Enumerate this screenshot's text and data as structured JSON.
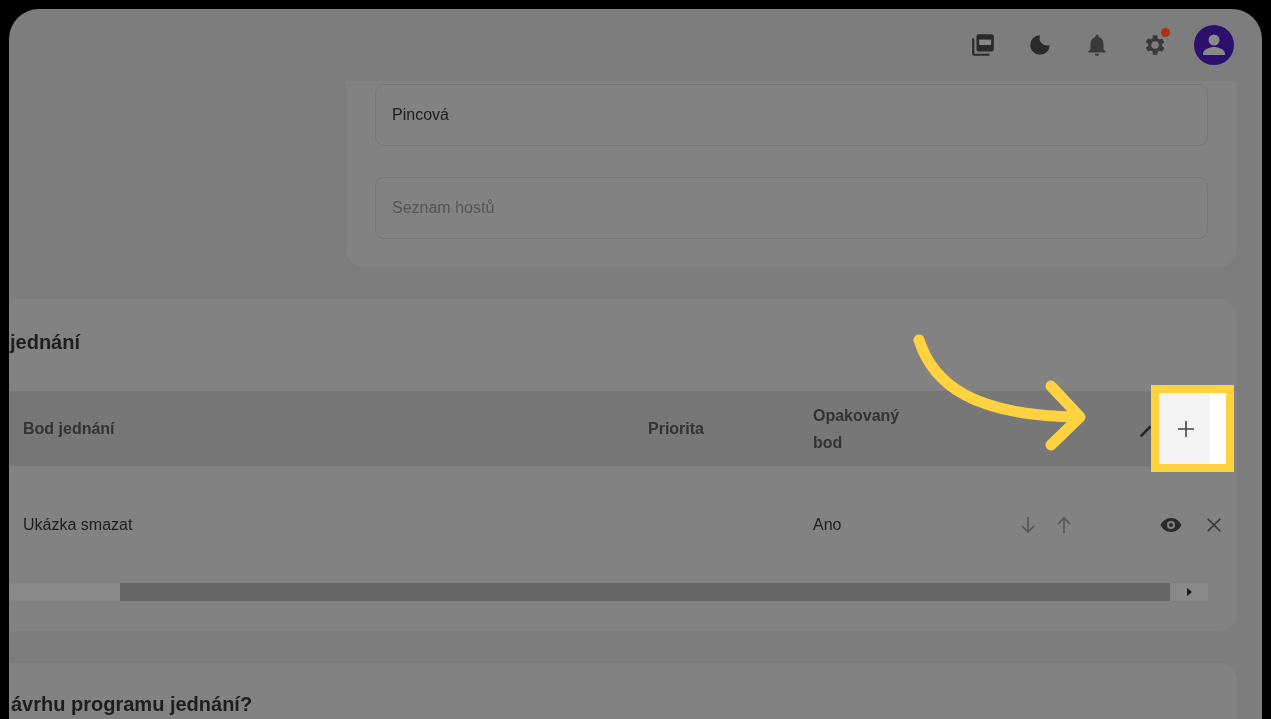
{
  "toolbar": {
    "settings_badge": true
  },
  "details": {
    "fields": [
      {
        "value": "Pincová"
      },
      {
        "placeholder": "Seznam hostů"
      }
    ]
  },
  "agenda": {
    "title": "jednání",
    "columns": [
      "Bod jednání",
      "Priorita",
      "Opakovaný bod"
    ],
    "rows": [
      {
        "item": "Ukázka smazat",
        "repeated": "Ano"
      }
    ],
    "add_button": {
      "highlighted": true
    }
  },
  "next_section": {
    "title": "ávrhu programu jednání?"
  }
}
